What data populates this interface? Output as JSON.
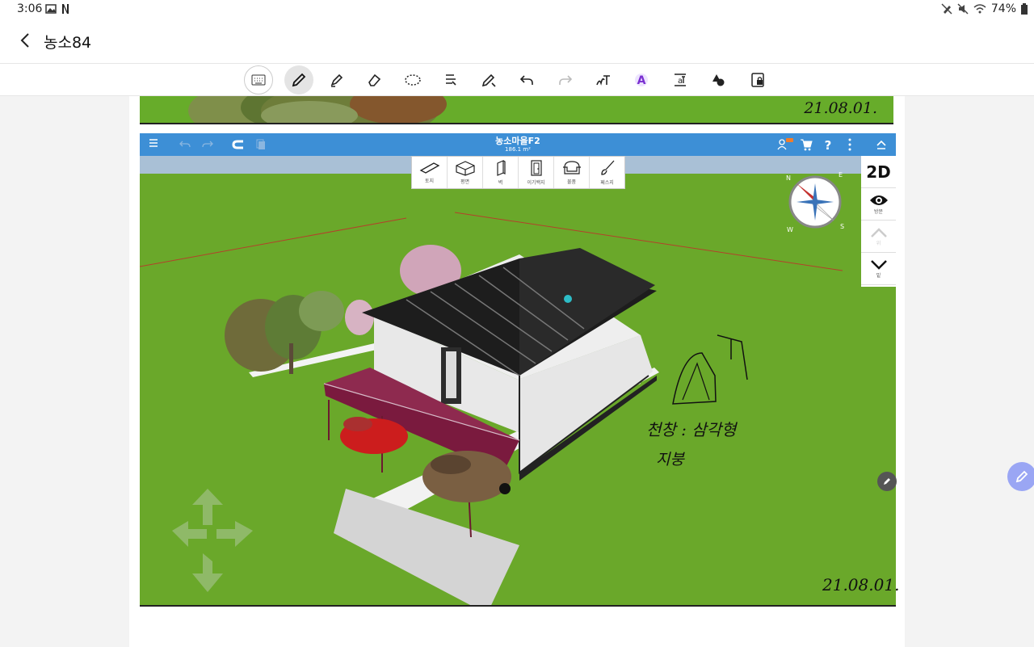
{
  "status": {
    "time": "3:06",
    "battery": "74%"
  },
  "app": {
    "title": "농소84"
  },
  "toolbar": {
    "tools": [
      "keyboard-icon",
      "pen-icon",
      "highlighter-icon",
      "eraser-icon",
      "lasso-icon",
      "text-select-icon",
      "pen-settings-icon",
      "undo-icon",
      "redo-icon",
      "handwriting-text-icon",
      "text-color-icon",
      "text-format-icon",
      "shapes-icon",
      "lock-icon"
    ]
  },
  "prev_note": {
    "date": "21.08.01."
  },
  "homestyler": {
    "project_title": "농소마을F2",
    "area": "186.1 m²",
    "tools": [
      {
        "label": "토지",
        "icon": "floor-icon"
      },
      {
        "label": "평면",
        "icon": "room-icon"
      },
      {
        "label": "벽",
        "icon": "wall-icon"
      },
      {
        "label": "이기백지",
        "icon": "door-icon"
      },
      {
        "label": "물품",
        "icon": "furniture-icon"
      },
      {
        "label": "페스지",
        "icon": "paint-brush-icon"
      }
    ],
    "side": {
      "view_2d": "2D",
      "eye_label": "방문",
      "up_label": "위",
      "down_label": "밑"
    },
    "compass": {
      "n": "N",
      "e": "E",
      "s": "S",
      "w": "W"
    }
  },
  "notes": {
    "line1": "천창 : 삼각형",
    "line2": "지붕",
    "date": "21.08.01."
  }
}
